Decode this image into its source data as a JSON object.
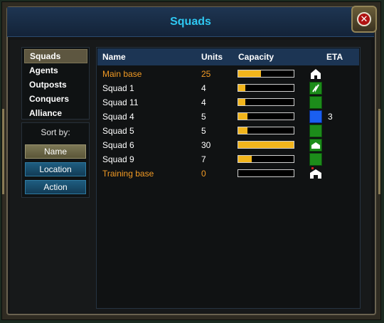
{
  "window": {
    "title": "Squads",
    "close_label": "✕"
  },
  "nav": {
    "items": [
      {
        "label": "Squads",
        "active": true
      },
      {
        "label": "Agents",
        "active": false
      },
      {
        "label": "Outposts",
        "active": false
      },
      {
        "label": "Conquers",
        "active": false
      },
      {
        "label": "Alliance",
        "active": false
      }
    ]
  },
  "sort": {
    "label": "Sort by:",
    "buttons": [
      {
        "label": "Name",
        "active": true
      },
      {
        "label": "Location",
        "active": false
      },
      {
        "label": "Action",
        "active": false
      }
    ]
  },
  "table": {
    "headers": {
      "name": "Name",
      "units": "Units",
      "capacity": "Capacity",
      "eta": "ETA"
    },
    "rows": [
      {
        "name": "Main base",
        "units": "25",
        "capacity": 0.41,
        "icon": "house-icon",
        "eta": "",
        "highlight": true
      },
      {
        "name": "Squad 1",
        "units": "4",
        "capacity": 0.13,
        "icon": "lightning-icon",
        "eta": "",
        "highlight": false
      },
      {
        "name": "Squad 11",
        "units": "4",
        "capacity": 0.13,
        "icon": "green-square-icon",
        "eta": "",
        "highlight": false
      },
      {
        "name": "Squad 4",
        "units": "5",
        "capacity": 0.17,
        "icon": "blue-square-icon",
        "eta": "3",
        "highlight": false
      },
      {
        "name": "Squad 5",
        "units": "5",
        "capacity": 0.17,
        "icon": "green-square-icon",
        "eta": "",
        "highlight": false
      },
      {
        "name": "Squad 6",
        "units": "30",
        "capacity": 1.0,
        "icon": "outpost-icon",
        "eta": "",
        "highlight": false
      },
      {
        "name": "Squad 9",
        "units": "7",
        "capacity": 0.24,
        "icon": "green-square-icon",
        "eta": "",
        "highlight": false
      },
      {
        "name": "Training base",
        "units": "0",
        "capacity": 0.0,
        "icon": "training-base-icon",
        "eta": "",
        "highlight": true
      }
    ]
  },
  "colors": {
    "title": "#2ec8f2",
    "highlight_text": "#f19a24",
    "capacity_fill": "#f2b51c",
    "icon_green": "#1c8c1a",
    "icon_blue": "#1a5ff0"
  }
}
